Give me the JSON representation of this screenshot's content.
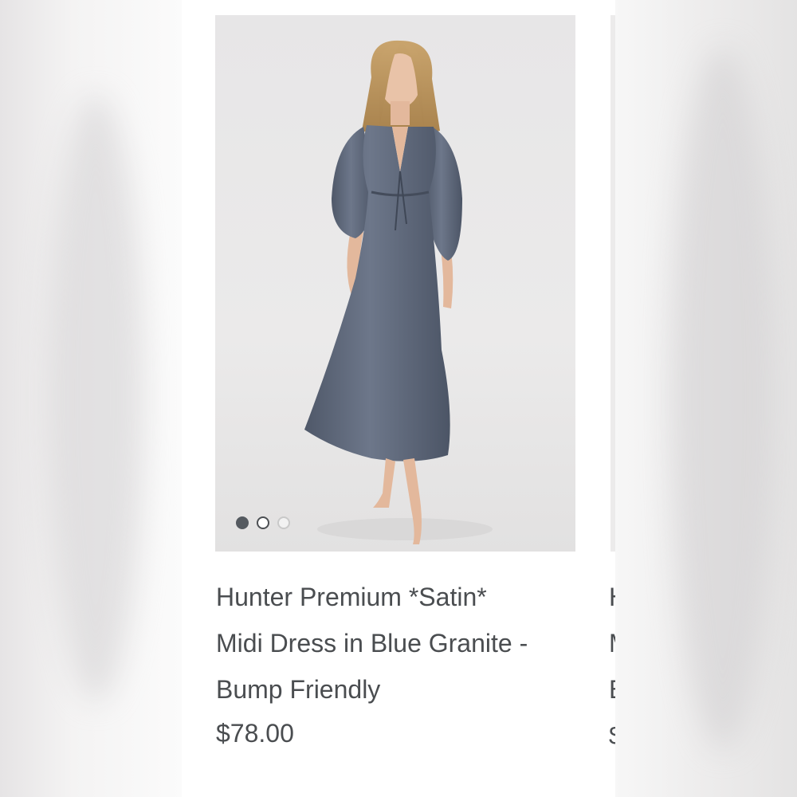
{
  "product": {
    "title_line1": "Hunter Premium *Satin*",
    "title_line2": "Midi Dress in Blue Granite -",
    "title_line3": "Bump Friendly",
    "price": "$78.00",
    "image_alt": "Model wearing satin midi dress in blue granite",
    "carousel": {
      "total": 3,
      "active": 1
    }
  },
  "next_product": {
    "text_line1": "H",
    "text_line2": "M",
    "text_line3": "B",
    "text_line4": "$"
  },
  "colors": {
    "dress": "#5d6677",
    "text": "#4a4d50",
    "background": "#ffffff"
  }
}
